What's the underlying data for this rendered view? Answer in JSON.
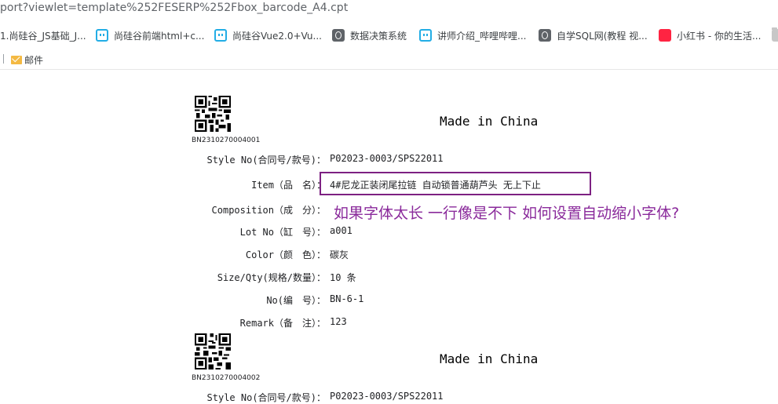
{
  "browser": {
    "address_text": "port?viewlet=template%252FESERP%252Fbox_barcode_A4.cpt",
    "bookmarks": [
      {
        "label": "1.尚硅谷_JS基础_J...",
        "icon": "folder-icon"
      },
      {
        "label": "尚硅谷前端html+c...",
        "icon": "bilibili-icon"
      },
      {
        "label": "尚硅谷Vue2.0+Vu...",
        "icon": "bilibili-icon"
      },
      {
        "label": "数据决策系统",
        "icon": "globe-icon"
      },
      {
        "label": "讲师介绍_哔哩哔哩...",
        "icon": "bilibili-icon"
      },
      {
        "label": "自学SQL网(教程 视...",
        "icon": "globe-icon"
      },
      {
        "label": "小红书 - 你的生活...",
        "icon": "xiaohongshu-icon"
      }
    ],
    "subbar_mail": "邮件"
  },
  "labels": [
    {
      "code": "BN2310270004001",
      "made": "Made in China",
      "rows": [
        {
          "label": "Style No(合同号/款号)：",
          "value": "P02023-0003/SPS22011"
        },
        {
          "label": "Item（品　名）：",
          "value": "4#尼龙正装闭尾拉链 自动锁普通葫芦头 无上下止"
        },
        {
          "label": "Composition（成　分）：",
          "value": ""
        },
        {
          "label": "Lot No（缸　号）：",
          "value": "a001"
        },
        {
          "label": "Color（颜　色）：",
          "value": "碳灰"
        },
        {
          "label": "Size/Qty(规格/数量）：",
          "value": "10 条"
        },
        {
          "label": "No(编　号）：",
          "value": "BN-6-1"
        },
        {
          "label": "Remark（备　注）：",
          "value": "123"
        }
      ]
    },
    {
      "code": "BN2310270004002",
      "made": "Made in China",
      "rows": [
        {
          "label": "Style No(合同号/款号)：",
          "value": "P02023-0003/SPS22011"
        }
      ]
    }
  ],
  "annotation": {
    "text": "如果字体太长 一行像是不下 如何设置自动缩小字体?",
    "color": "#8a2a9b"
  }
}
